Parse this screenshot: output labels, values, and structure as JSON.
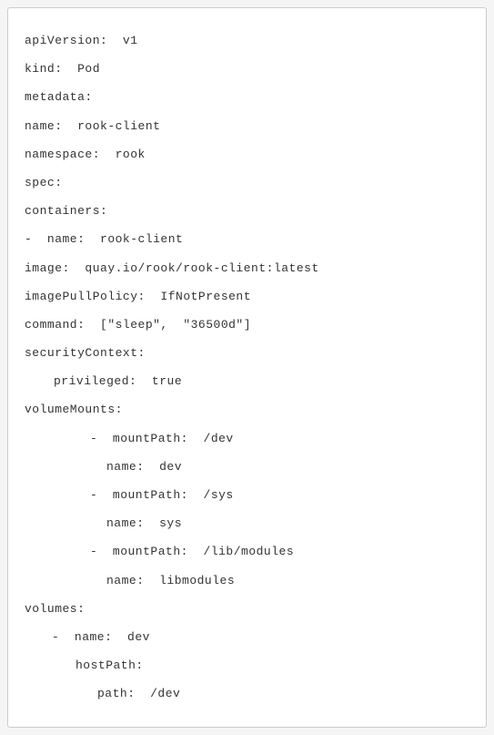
{
  "yaml": {
    "apiVersion": "apiVersion:  v1",
    "kind": "kind:  Pod",
    "metadata": "metadata:",
    "name": "name:  rook-client",
    "namespace": "namespace:  rook",
    "spec": "spec:",
    "containers": "containers:",
    "containerName": "-  name:  rook-client",
    "image": "image:  quay.io/rook/rook-client:latest",
    "imagePullPolicy": "imagePullPolicy:  IfNotPresent",
    "command": "command:  [″sleep″,  ″36500d″]",
    "securityContext": "securityContext:",
    "privileged": "privileged:  true",
    "volumeMounts": "volumeMounts:",
    "mount1Path": "-  mountPath:  /dev",
    "mount1Name": "name:  dev",
    "mount2Path": "-  mountPath:  /sys",
    "mount2Name": "name:  sys",
    "mount3Path": "-  mountPath:  /lib/modules",
    "mount3Name": "name:  libmodules",
    "volumes": "volumes:",
    "vol1Name": "-  name:  dev",
    "vol1HostPath": "hostPath:",
    "vol1Path": "path:  /dev"
  }
}
